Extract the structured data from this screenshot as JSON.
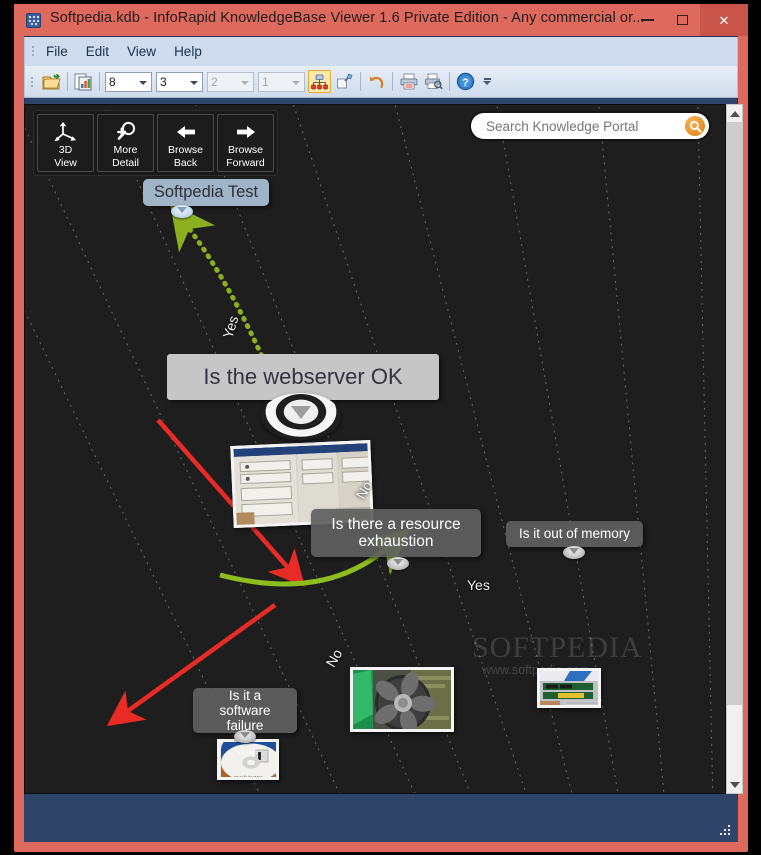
{
  "window": {
    "title": "Softpedia.kdb - InfoRapid KnowledgeBase Viewer 1.6 Private Edition - Any commercial or...",
    "app_icon": "kdb-app-icon",
    "minimize_label": "",
    "maximize_label": "",
    "close_label": "✕",
    "frame_color": "#dd6a5c",
    "inner_color": "#2e4468",
    "close_hover_color": "#c9544a"
  },
  "menu": {
    "items": [
      {
        "label": "File"
      },
      {
        "label": "Edit"
      },
      {
        "label": "View"
      },
      {
        "label": "Help"
      }
    ]
  },
  "toolbar": {
    "buttons": [
      {
        "name": "open-file-icon",
        "glyph": "open-folder"
      },
      {
        "name": "report-icon",
        "glyph": "chart-page"
      }
    ],
    "combos": [
      {
        "name": "levels-combo",
        "value": "8",
        "disabled": false
      },
      {
        "name": "depth-combo",
        "value": "3",
        "disabled": false
      },
      {
        "name": "option-combo-1",
        "value": "2",
        "disabled": true
      },
      {
        "name": "option-combo-2",
        "value": "1",
        "disabled": true
      }
    ],
    "buttons2": [
      {
        "name": "tree-layout-icon",
        "glyph": "network-tree",
        "selected": true
      },
      {
        "name": "pin-icon",
        "glyph": "pin",
        "selected": false
      }
    ],
    "buttons3": [
      {
        "name": "undo-icon",
        "glyph": "undo"
      }
    ],
    "buttons4": [
      {
        "name": "print-icon",
        "glyph": "print"
      },
      {
        "name": "print-preview-icon",
        "glyph": "print-search"
      }
    ],
    "buttons5": [
      {
        "name": "help-icon",
        "glyph": "question-circle"
      }
    ],
    "overflow_label": ""
  },
  "palette": {
    "buttons": [
      {
        "name": "3d-view-button",
        "icon": "three-d-axes-icon",
        "line1": "3D",
        "line2": "View"
      },
      {
        "name": "more-detail-button",
        "icon": "magnifier-plus-icon",
        "line1": "More",
        "line2": "Detail"
      },
      {
        "name": "browse-back-button",
        "icon": "arrow-left-icon",
        "line1": "Browse",
        "line2": "Back"
      },
      {
        "name": "browse-forward-button",
        "icon": "arrow-right-icon",
        "line1": "Browse",
        "line2": "Forward"
      }
    ]
  },
  "search": {
    "placeholder": "Search Knowledge Portal",
    "value": "",
    "icon": "search-icon",
    "icon_color": "#e07d10"
  },
  "graph": {
    "nodes": [
      {
        "id": "root",
        "label": "Softpedia Test",
        "style": "root"
      },
      {
        "id": "focus",
        "label": "Is the webserver OK",
        "style": "focus"
      },
      {
        "id": "resource",
        "label": "Is there a resource exhaustion",
        "style": "dark"
      },
      {
        "id": "memory",
        "label": "Is it out of memory",
        "style": "dark"
      },
      {
        "id": "software",
        "label": "Is it a software failure",
        "style": "dark"
      }
    ],
    "edges": [
      {
        "from": "focus",
        "to": "root",
        "label": "Yes",
        "color": "#8ab020",
        "style": "dotted"
      },
      {
        "from": "focus",
        "to": "resource",
        "label": "No",
        "color": "#e82b24",
        "style": "solid"
      },
      {
        "from": "resource",
        "to": "memory",
        "label": "Yes",
        "color": "#8dbe1e",
        "style": "solid"
      },
      {
        "from": "resource",
        "to": "software",
        "label": "No",
        "color": "#e82b24",
        "style": "solid"
      }
    ],
    "thumbnails": [
      {
        "name": "thumbnail-servers",
        "caption": "computer-towers-photo"
      },
      {
        "name": "thumbnail-memory",
        "caption": "ram-modules-photo"
      },
      {
        "name": "thumbnail-cpu-fan",
        "caption": "cpu-cooler-photo"
      },
      {
        "name": "thumbnail-cd",
        "caption": "inforapid-cd-photo"
      }
    ],
    "watermark_line1": "SOFTPEDIA",
    "watermark_line2": "www.softpedia.com",
    "background_color": "#1e1e1e"
  },
  "scrollbar": {
    "up_label": "",
    "down_label": ""
  },
  "statusbar": {
    "text": ""
  }
}
